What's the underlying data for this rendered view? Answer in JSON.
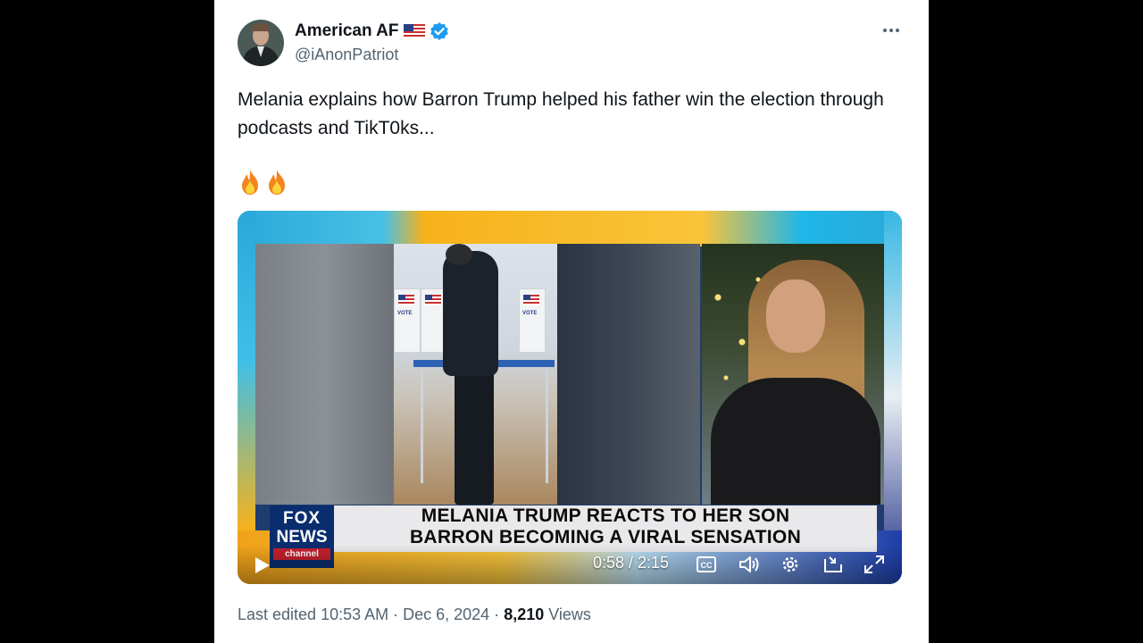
{
  "author": {
    "display_name": "American AF",
    "handle": "@iAnonPatriot"
  },
  "tweet": {
    "text": "Melania explains how Barron Trump helped his father win the election through podcasts and TikT0ks...",
    "emojis": [
      "🔥",
      "🔥"
    ]
  },
  "media": {
    "booth_label": "VOTE",
    "logo": {
      "fox": "FOX",
      "news": "NEWS",
      "channel": "channel"
    },
    "headline_line1": "MELANIA TRUMP REACTS TO HER SON",
    "headline_line2": "BARRON BECOMING A VIRAL SENSATION",
    "player": {
      "current_time": "0:58",
      "duration_display": "0:58 / 2:15",
      "progress": 0.43
    }
  },
  "footer": {
    "edited": "Last edited 10:53 AM · Dec 6, 2024 · ",
    "views_count": "8,210",
    "views_label": " Views"
  },
  "colors": {
    "text_primary": "#0f1419",
    "text_secondary": "#536471",
    "verified_blue": "#1d9bf0"
  },
  "icons": [
    "flag-icon",
    "verified-icon",
    "more-icon",
    "fire-icon",
    "play-icon",
    "captions-icon",
    "volume-icon",
    "settings-icon",
    "pip-icon",
    "fullscreen-icon"
  ]
}
